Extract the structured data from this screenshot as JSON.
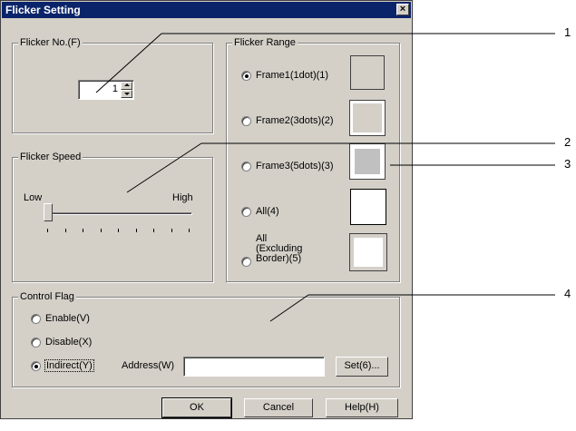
{
  "dialog": {
    "title": "Flicker Setting",
    "close_glyph": "×"
  },
  "flicker_no": {
    "group_label": "Flicker No.(F)",
    "value": "1"
  },
  "flicker_speed": {
    "group_label": "Flicker Speed",
    "low_label": "Low",
    "high_label": "High",
    "level_fraction": 0.0
  },
  "flicker_range": {
    "group_label": "Flicker Range",
    "options": [
      {
        "label": "Frame1(1dot)(1)",
        "selected": true
      },
      {
        "label": "Frame2(3dots)(2)",
        "selected": false
      },
      {
        "label": "Frame3(5dots)(3)",
        "selected": false
      },
      {
        "label": "All(4)",
        "selected": false
      },
      {
        "label_lines": [
          "All",
          "(Excluding",
          "Border)(5)"
        ],
        "selected": false
      }
    ]
  },
  "control_flag": {
    "group_label": "Control Flag",
    "enable_label": "Enable(V)",
    "disable_label": "Disable(X)",
    "indirect_label": "Indirect(Y)",
    "selected": "Indirect(Y)",
    "address_label": "Address(W)",
    "address_value": "",
    "set_button": "Set(6)..."
  },
  "buttons": {
    "ok": "OK",
    "cancel": "Cancel",
    "help": "Help(H)"
  },
  "callouts": [
    "1",
    "2",
    "3",
    "4"
  ]
}
